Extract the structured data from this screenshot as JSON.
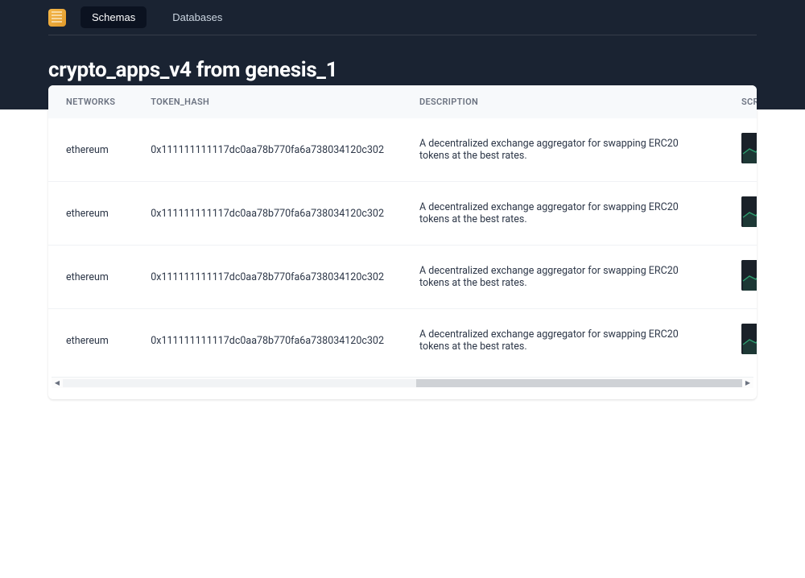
{
  "nav": {
    "tabs": [
      {
        "label": "Schemas",
        "active": true
      },
      {
        "label": "Databases",
        "active": false
      }
    ]
  },
  "page": {
    "title": "crypto_apps_v4 from genesis_1"
  },
  "table": {
    "columns": [
      {
        "label": "NETWORKS"
      },
      {
        "label": "TOKEN_HASH"
      },
      {
        "label": "DESCRIPTION"
      },
      {
        "label": "SCREENSHOTS"
      }
    ],
    "rows": [
      {
        "networks": "ethereum",
        "token_hash": "0x111111111117dc0aa78b770fa6a738034120c302",
        "description": "A decentralized exchange aggregator for swapping ERC20 tokens at the best rates."
      },
      {
        "networks": "ethereum",
        "token_hash": "0x111111111117dc0aa78b770fa6a738034120c302",
        "description": "A decentralized exchange aggregator for swapping ERC20 tokens at the best rates."
      },
      {
        "networks": "ethereum",
        "token_hash": "0x111111111117dc0aa78b770fa6a738034120c302",
        "description": "A decentralized exchange aggregator for swapping ERC20 tokens at the best rates."
      },
      {
        "networks": "ethereum",
        "token_hash": "0x111111111117dc0aa78b770fa6a738034120c302",
        "description": "A decentralized exchange aggregator for swapping ERC20 tokens at the best rates."
      }
    ]
  }
}
